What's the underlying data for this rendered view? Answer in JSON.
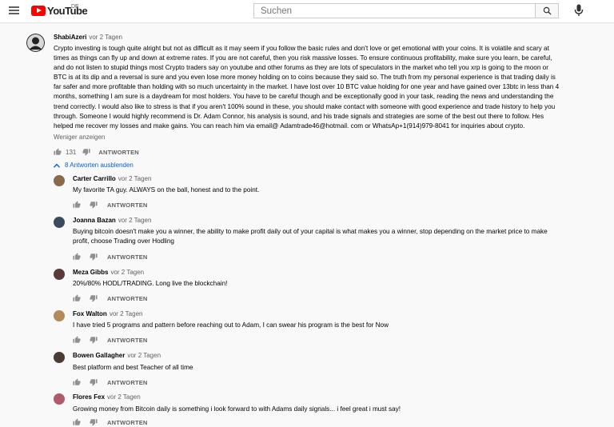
{
  "header": {
    "logo_text": "YouTube",
    "country_code": "DE",
    "search_placeholder": "Suchen"
  },
  "main_comment": {
    "author": "ShabiAzeri",
    "time": "vor 2 Tagen",
    "lines": [
      "Crypto investing is tough quite alright but not as difficult as it may seem if you follow the basic rules and don't love or get emotional with your coins. It is volatile and scary at",
      "times as things can fly up and down at extreme rates. If you are not careful, then you risk massive losses. To ensure continuous profitability, make sure you learn, be careful,",
      "and do not listen to stupid things most Crypto traders say on youtube and other forums as they are lots of speculators in the market who tell you xrp is going to the moon or",
      "BTC is at its dip and a reversal is sure and you even lose more money holding on to coins because they said so. The truth from my personal experience is that trading daily is",
      "far safer and more profitable than holding with so much uncertainty in the market. I have lost over 10 BTC value holding for one year and have gained over 13btc in less than 4",
      "months, something I am sure is a daydream for most holders. You have to be careful though and be exceptionally good in your task, reading the news and understanding the",
      "trend correctly. I would also like to stress is that if you aren't 100% sound in these, you should make contact with someone with good experience and trade history to help you",
      "through. Someone I would highly recommend is Dr. Adam Connor, his analysis is sound, and his trade signals and strategies are some of the best out there to follow. Hes",
      "helped me recover my losses and make gains. You can reach him via email@ Adamtrade46@hotmail. com or WhatsAp+1(914)979-8041 for inquiries about crypto."
    ],
    "show_less": "Weniger anzeigen",
    "likes": "131",
    "reply_label": "ANTWORTEN",
    "hide_replies": "8 Antworten ausblenden"
  },
  "replies": [
    {
      "author": "Carter Carrillo",
      "time": "vor 2 Tagen",
      "lines": [
        "My favorite TA guy.  ALWAYS on the ball, honest and to the point."
      ],
      "reply_label": "ANTWORTEN",
      "avatar_color": "#8a6a4c"
    },
    {
      "author": "Joanna Bazan",
      "time": "vor 2 Tagen",
      "lines": [
        "Buying bitcoin doesn't make you a winner, the ability to make profit daily out of your capital is what makes you a winner, stop depending on the market price to make",
        "profit, choose Trading over Hodling"
      ],
      "reply_label": "ANTWORTEN",
      "avatar_color": "#3b4b5e"
    },
    {
      "author": "Meza Gibbs",
      "time": "vor 2 Tagen",
      "lines": [
        "20%/80% HODL/TRADING. Long live the blockchain!"
      ],
      "reply_label": "ANTWORTEN",
      "avatar_color": "#5b3a3a"
    },
    {
      "author": "Fox Walton",
      "time": "vor 2 Tagen",
      "lines": [
        "I have tried 5 programs and pattern before reaching out to Adam, I can swear his program is the best for Now"
      ],
      "reply_label": "ANTWORTEN",
      "avatar_color": "#b48a5a"
    },
    {
      "author": "Bowen Gallagher",
      "time": "vor 2 Tagen",
      "lines": [
        "Best platform and best Teacher of all time"
      ],
      "reply_label": "ANTWORTEN",
      "avatar_color": "#4a3b34"
    },
    {
      "author": "Flores Fex",
      "time": "vor 2 Tagen",
      "lines": [
        "Growing money from Bitcoin daily is something i look forward to with Adams daily signals... i feel great i must say!"
      ],
      "reply_label": "ANTWORTEN",
      "avatar_color": "#b05a6a"
    }
  ],
  "colors": {
    "link_blue": "#065fd4",
    "youtube_red": "#ff0000",
    "secondary_text": "#606060"
  },
  "icons": {
    "menu": "hamburger-menu-icon",
    "search": "search-icon",
    "mic": "microphone-icon",
    "like": "thumbs-up-icon",
    "dislike": "thumbs-down-icon",
    "collapse": "chevron-up-icon"
  }
}
